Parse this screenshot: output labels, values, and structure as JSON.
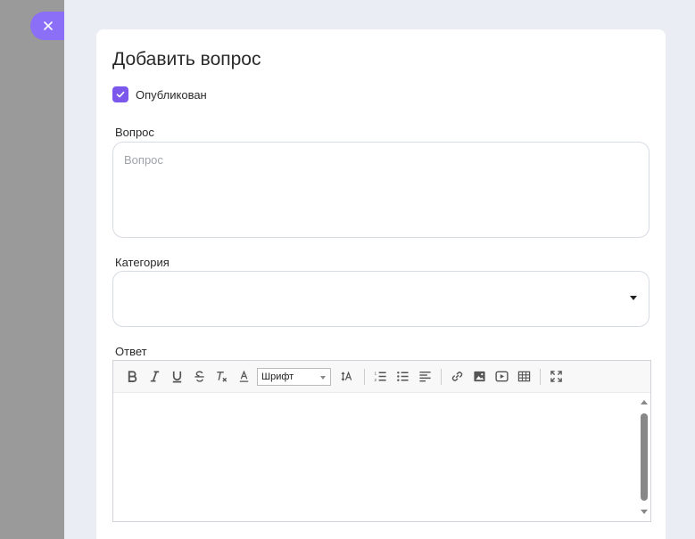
{
  "modal": {
    "title": "Добавить вопрос",
    "published": {
      "label": "Опубликован",
      "checked": true
    },
    "question": {
      "label": "Вопрос",
      "placeholder": "Вопрос",
      "value": ""
    },
    "category": {
      "label": "Категория",
      "value": ""
    },
    "answer": {
      "label": "Ответ",
      "toolbar": {
        "font_label": "Шрифт",
        "buttons": [
          "bold-icon",
          "italic-icon",
          "underline-icon",
          "strikethrough-icon",
          "clear-format-icon",
          "text-color-icon",
          "font-size-icon",
          "numbered-list-icon",
          "bullet-list-icon",
          "align-icon",
          "link-icon",
          "image-icon",
          "video-icon",
          "table-icon",
          "fullscreen-icon"
        ]
      },
      "value": ""
    }
  },
  "colors": {
    "accent": "#7b57ec",
    "close_button": "#8b6ff6",
    "drawer_bg": "#eaeef4",
    "overlay": "#9a9a9a"
  }
}
